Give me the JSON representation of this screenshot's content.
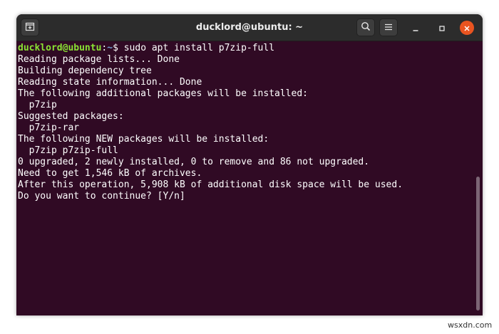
{
  "window": {
    "title": "ducklord@ubuntu: ~",
    "buttons": {
      "new_tab_icon": "new-tab-icon",
      "search_icon": "search-icon",
      "menu_icon": "hamburger-menu-icon",
      "minimize_icon": "minimize-icon",
      "maximize_icon": "maximize-icon",
      "close_icon": "close-icon"
    }
  },
  "terminal": {
    "prompt": {
      "user_host": "ducklord@ubuntu",
      "separator": ":",
      "path": "~",
      "symbol": "$",
      "command": " sudo apt install p7zip-full"
    },
    "output": [
      "Reading package lists... Done",
      "Building dependency tree",
      "Reading state information... Done",
      "The following additional packages will be installed:",
      "  p7zip",
      "Suggested packages:",
      "  p7zip-rar",
      "The following NEW packages will be installed:",
      "  p7zip p7zip-full",
      "0 upgraded, 2 newly installed, 0 to remove and 86 not upgraded.",
      "Need to get 1,546 kB of archives.",
      "After this operation, 5,908 kB of additional disk space will be used.",
      "Do you want to continue? [Y/n]"
    ]
  },
  "watermark": "wsxdn.com",
  "colors": {
    "terminal_bg": "#300a24",
    "titlebar_bg": "#2c2c2c",
    "prompt_user": "#8ae234",
    "prompt_path": "#729fcf",
    "close_button": "#e95420"
  }
}
